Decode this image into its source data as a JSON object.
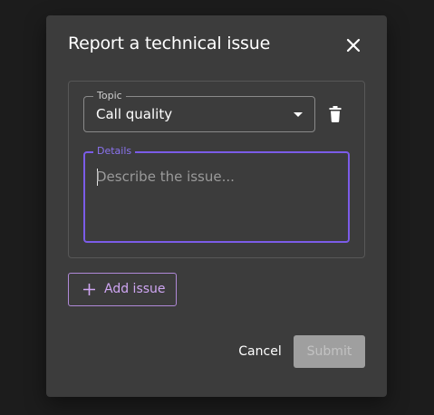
{
  "dialog": {
    "title": "Report a technical issue",
    "close_icon": "close-icon"
  },
  "issues": [
    {
      "topic_label": "Topic",
      "topic_value": "Call quality",
      "dropdown_icon": "caret-down-icon",
      "delete_icon": "trash-icon",
      "details_label": "Details",
      "details_value": "",
      "details_placeholder": "Describe the issue..."
    }
  ],
  "actions": {
    "add_issue_label": "Add issue",
    "add_issue_icon": "plus-icon",
    "cancel_label": "Cancel",
    "submit_label": "Submit",
    "submit_disabled": true
  },
  "colors": {
    "background": "#1c1c1c",
    "dialog_bg": "#3c3c3c",
    "focus_accent": "#7b5ce8",
    "add_issue_accent": "#cfa6f3",
    "submit_disabled_bg": "#9f9f9f"
  }
}
